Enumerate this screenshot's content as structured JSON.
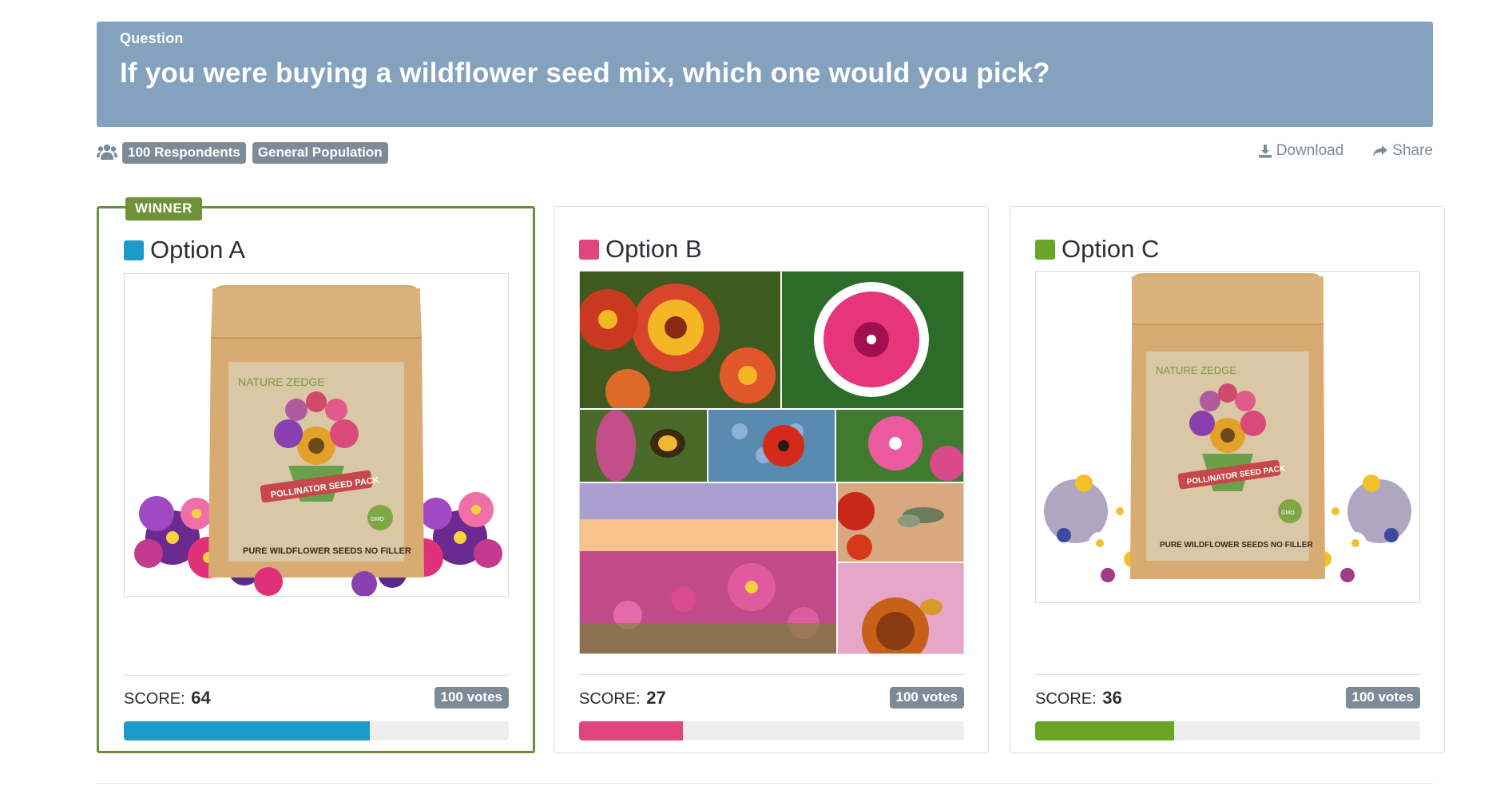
{
  "question": {
    "label": "Question",
    "text": "If you were buying a wildflower seed mix, which one would you pick?"
  },
  "meta": {
    "respondents": "100 Respondents",
    "audience": "General Population",
    "icon": "users-icon"
  },
  "actions": {
    "download": "Download",
    "share": "Share"
  },
  "winner_label": "WINNER",
  "score_label": "SCORE:",
  "options": [
    {
      "title": "Option A",
      "color": "#1c9ac9",
      "score": "64",
      "score_fraction": 0.64,
      "votes": "100 votes",
      "image": {
        "brand": "NATURE ZEDGE",
        "title": "POLLINATOR SEED PACK",
        "footer": "PURE WILDFLOWER SEEDS NO FILLER",
        "badge": "GMO FREE"
      }
    },
    {
      "title": "Option B",
      "color": "#e0457b",
      "score": "27",
      "score_fraction": 0.27,
      "votes": "100 votes"
    },
    {
      "title": "Option C",
      "color": "#6aa525",
      "score": "36",
      "score_fraction": 0.36,
      "votes": "100 votes",
      "image": {
        "brand": "NATURE ZEDGE",
        "title": "POLLINATOR SEED PACK",
        "footer": "PURE WILDFLOWER SEEDS NO FILLER",
        "badge": "GMO FREE"
      }
    }
  ]
}
